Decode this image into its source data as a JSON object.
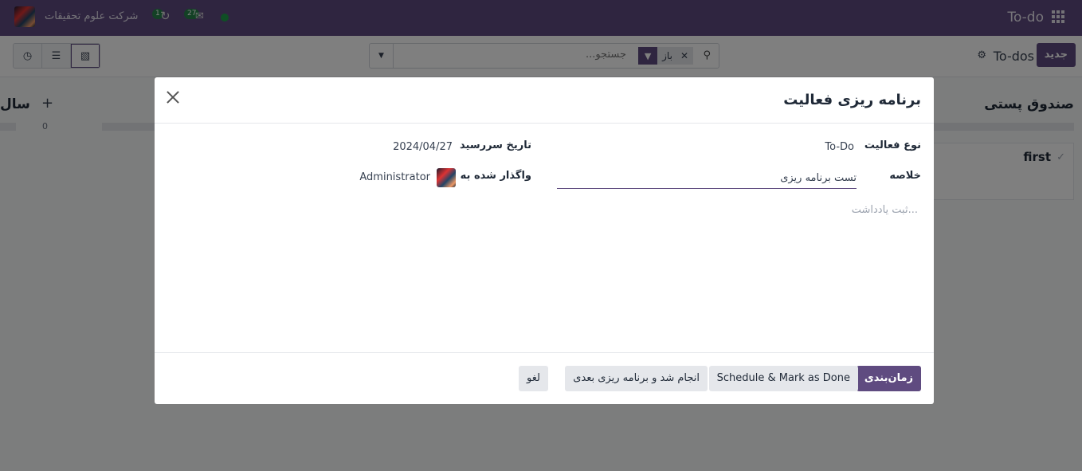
{
  "navbar": {
    "app_title": "To-do",
    "company": "شرکت علوم تحقیقات",
    "activity_count": "1",
    "message_count": "27"
  },
  "control_panel": {
    "new_button": "جدید",
    "breadcrumb": "To-dos",
    "search_placeholder": "جستجو...",
    "filter_facet": "باز"
  },
  "kanban": {
    "right_column_title": "صندوق پستی",
    "card_title": "first",
    "left_column_title": "سال",
    "left_column_count": "0"
  },
  "modal": {
    "title": "برنامه ریزی فعالیت",
    "activity_type_label": "نوع فعالیت",
    "activity_type_value": "To-Do",
    "due_date_label": "تاریخ سررسید",
    "due_date_value": "2024/04/27",
    "summary_label": "خلاصه",
    "summary_value": "تست برنامه ریزی",
    "assigned_label": "واگذار شده به",
    "assigned_value": "Administrator",
    "note_placeholder": "ثبت یادداشت...",
    "buttons": {
      "schedule": "زمان‌بندی",
      "schedule_done": "Schedule & Mark as Done",
      "done_next": "انجام شد و برنامه ریزی بعدی",
      "cancel": "لغو"
    }
  },
  "colors": {
    "brand": "#5f4b80",
    "badge": "#26834b"
  }
}
